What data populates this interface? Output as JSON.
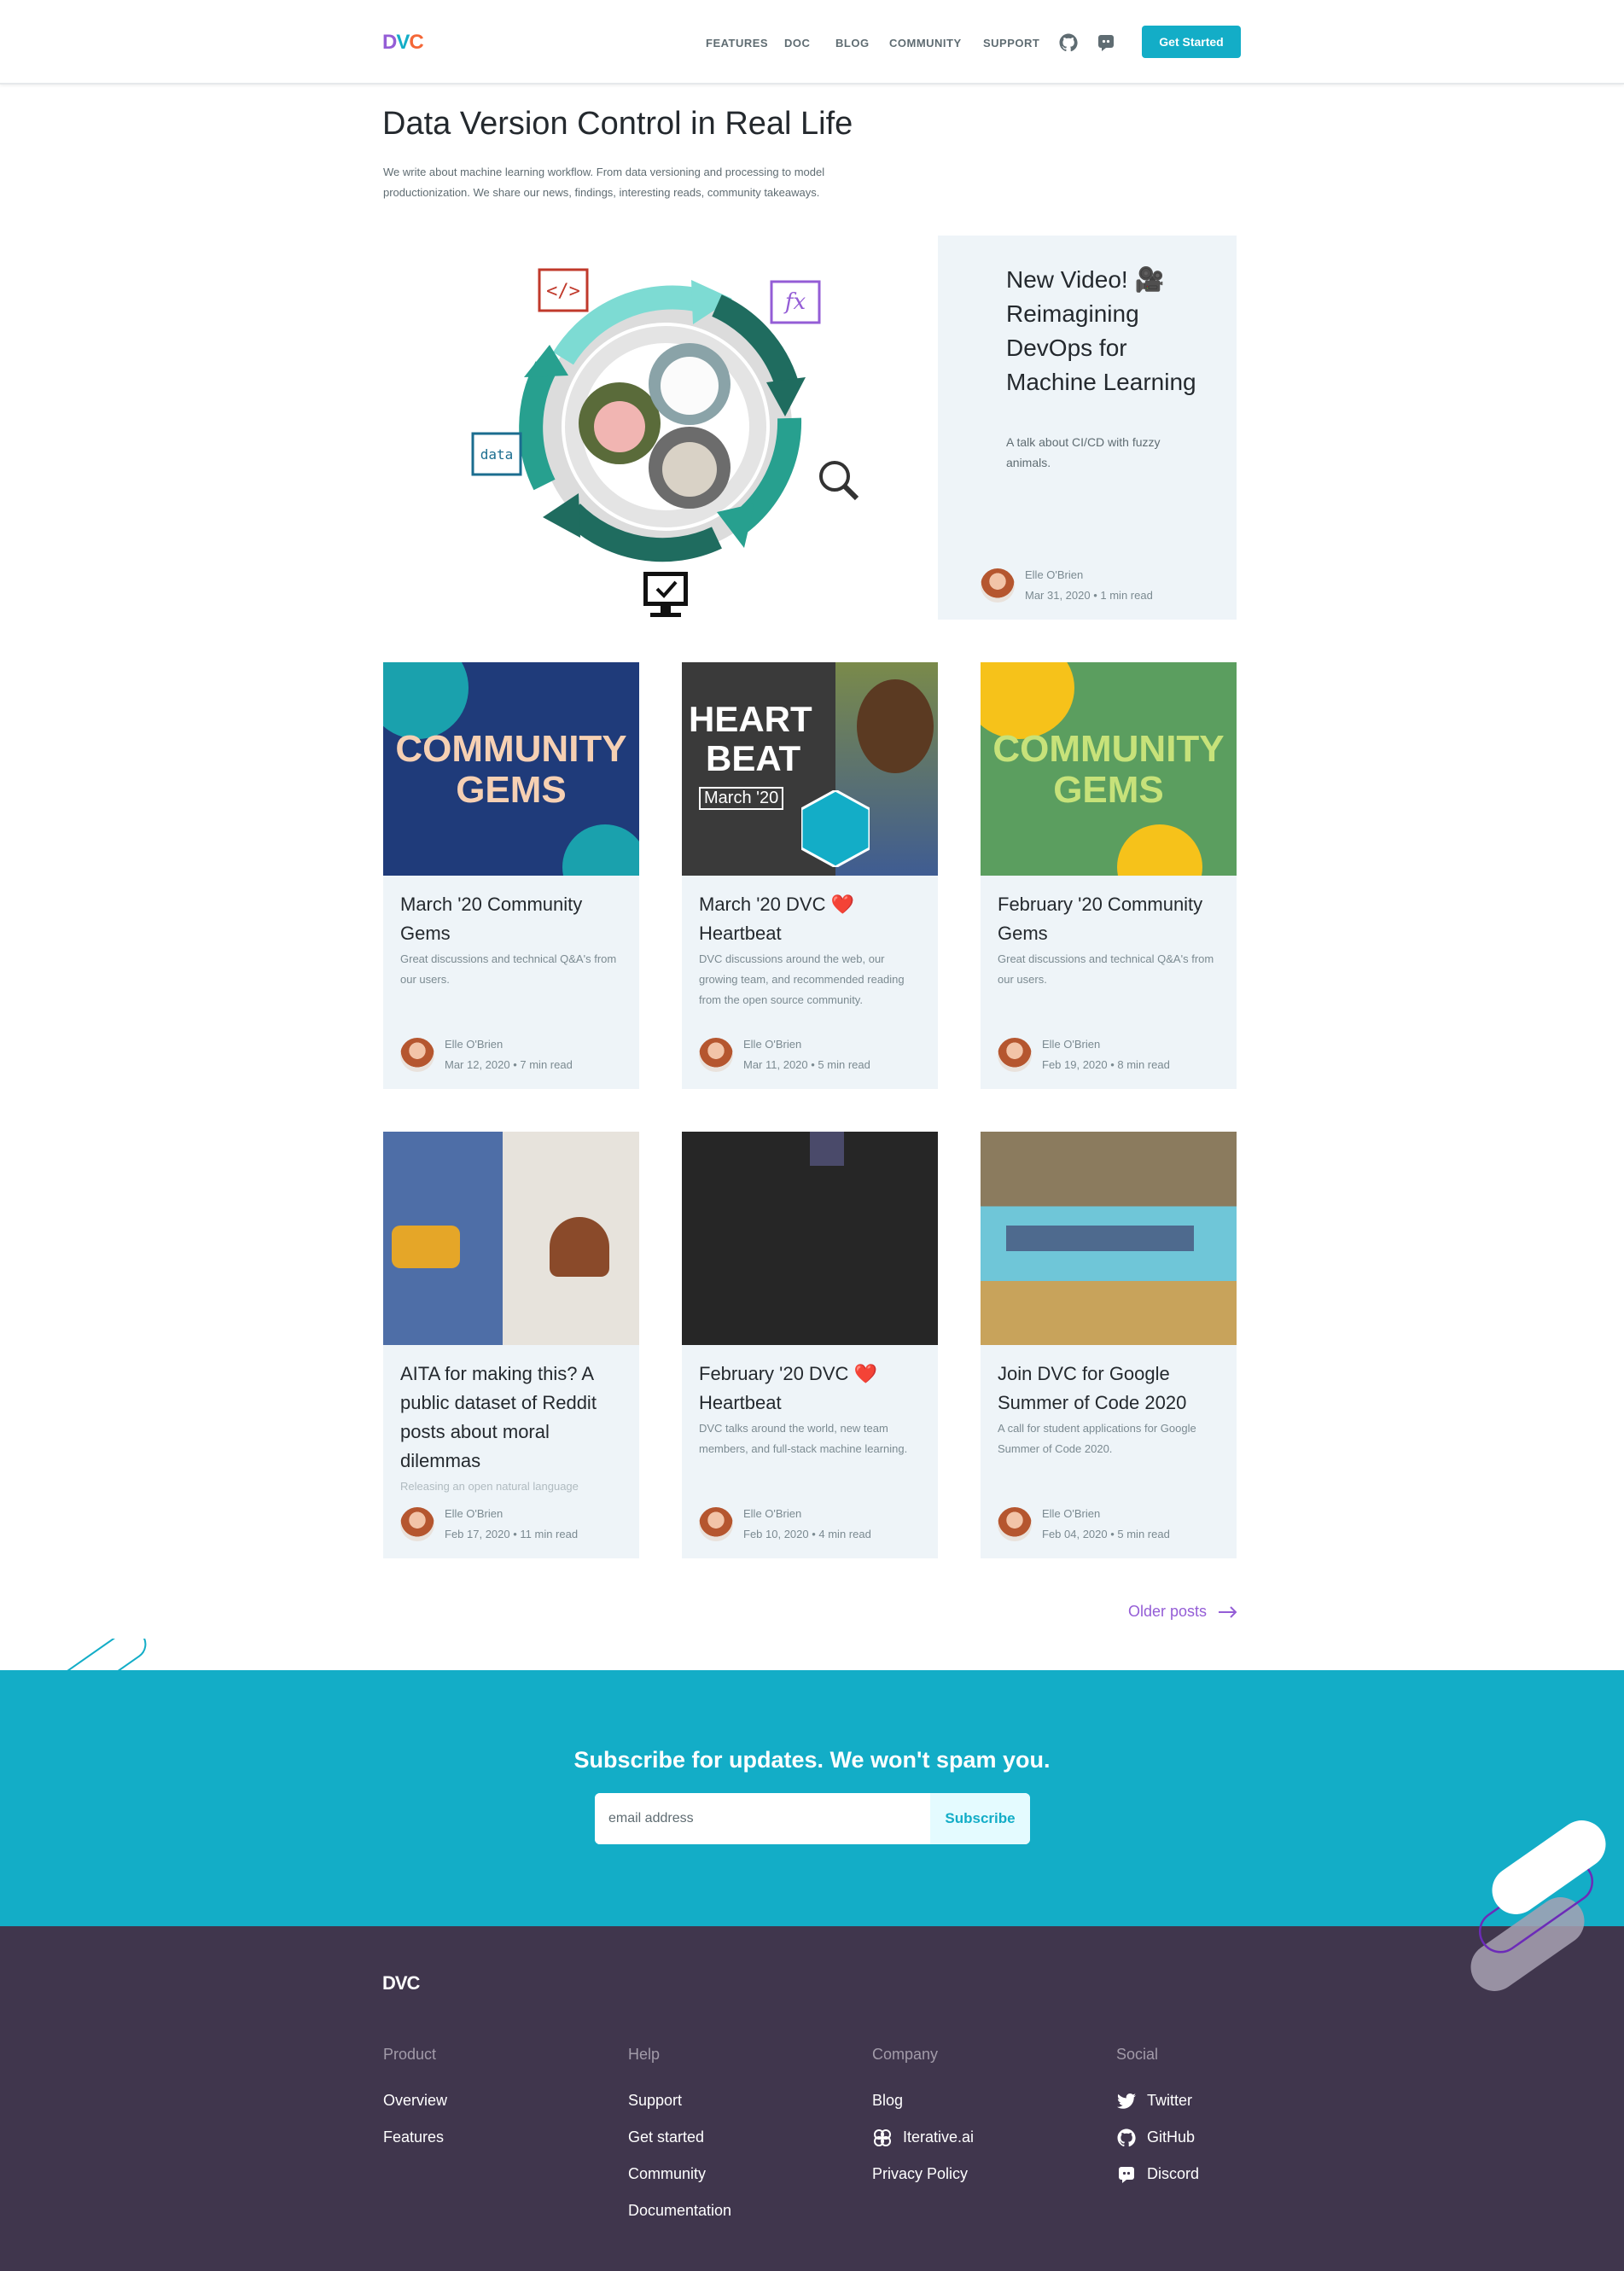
{
  "brand": {
    "logo": {
      "d": "D",
      "v": "V",
      "c": "C"
    }
  },
  "nav": {
    "items": [
      "FEATURES",
      "DOC",
      "BLOG",
      "COMMUNITY",
      "SUPPORT"
    ],
    "icons": [
      "github-icon",
      "discord-icon"
    ],
    "cta": "Get Started"
  },
  "intro": {
    "title": "Data Version Control in Real Life",
    "description": "We write about machine learning workflow. From data versioning and processing to model productionization. We share our news, findings, interesting reads, community takeaways."
  },
  "hero": {
    "labels": {
      "code": "</>",
      "fx": "fx",
      "data": "data"
    }
  },
  "featured": {
    "title": "New Video! 🎥 Reimagining DevOps for Machine Learning",
    "description": "A talk about CI/CD with fuzzy animals.",
    "author": "Elle O'Brien",
    "meta": "Mar 31, 2020 • 1 min read"
  },
  "posts": [
    {
      "title": "March '20 Community Gems",
      "description": "Great discussions and technical Q&A's from our users.",
      "author": "Elle O'Brien",
      "meta": "Mar 12, 2020 • 7 min read",
      "image_text": {
        "top": "COMMUNITY",
        "bottom": "GEMS"
      }
    },
    {
      "title": "March '20 DVC ❤️Heartbeat",
      "description": "DVC discussions around the web, our growing team, and recommended reading from the open source community.",
      "author": "Elle O'Brien",
      "meta": "Mar 11, 2020 • 5 min read",
      "image_text": {
        "top": "HEART",
        "bottom": "BEAT",
        "tag": "March '20"
      }
    },
    {
      "title": "February '20 Community Gems",
      "description": "Great discussions and technical Q&A's from our users.",
      "author": "Elle O'Brien",
      "meta": "Feb 19, 2020 • 8 min read",
      "image_text": {
        "top": "COMMUNITY",
        "bottom": "GEMS"
      }
    },
    {
      "title": "AITA for making this? A public dataset of Reddit posts about moral dilemmas",
      "description": "Releasing an open natural language",
      "author": "Elle O'Brien",
      "meta": "Feb 17, 2020 • 11 min read"
    },
    {
      "title": "February '20 DVC ❤️Heartbeat",
      "description": "DVC talks around the world, new team members, and full-stack machine learning.",
      "author": "Elle O'Brien",
      "meta": "Feb 10, 2020 • 4 min read"
    },
    {
      "title": "Join DVC for Google Summer of Code 2020",
      "description": "A call for student applications for Google Summer of Code 2020.",
      "author": "Elle O'Brien",
      "meta": "Feb 04, 2020 • 5 min read"
    }
  ],
  "pagination": {
    "older": "Older posts"
  },
  "subscribe": {
    "title": "Subscribe for updates. We won't spam you.",
    "placeholder": "email address",
    "button": "Subscribe"
  },
  "footer": {
    "logo": "DVC",
    "columns": [
      {
        "title": "Product",
        "links": [
          {
            "label": "Overview"
          },
          {
            "label": "Features"
          }
        ]
      },
      {
        "title": "Help",
        "links": [
          {
            "label": "Support"
          },
          {
            "label": "Get started"
          },
          {
            "label": "Community"
          },
          {
            "label": "Documentation"
          }
        ]
      },
      {
        "title": "Company",
        "links": [
          {
            "label": "Blog"
          },
          {
            "label": "Iterative.ai",
            "icon": "iterative-icon"
          },
          {
            "label": "Privacy Policy"
          }
        ]
      },
      {
        "title": "Social",
        "links": [
          {
            "label": "Twitter",
            "icon": "twitter-icon"
          },
          {
            "label": "GitHub",
            "icon": "github-icon"
          },
          {
            "label": "Discord",
            "icon": "discord-icon"
          }
        ]
      }
    ]
  },
  "colors": {
    "accent": "#13adc7",
    "purple": "#945dd6",
    "orange": "#f46737",
    "footer_bg": "#40364d",
    "card_bg": "#eef4f8"
  }
}
